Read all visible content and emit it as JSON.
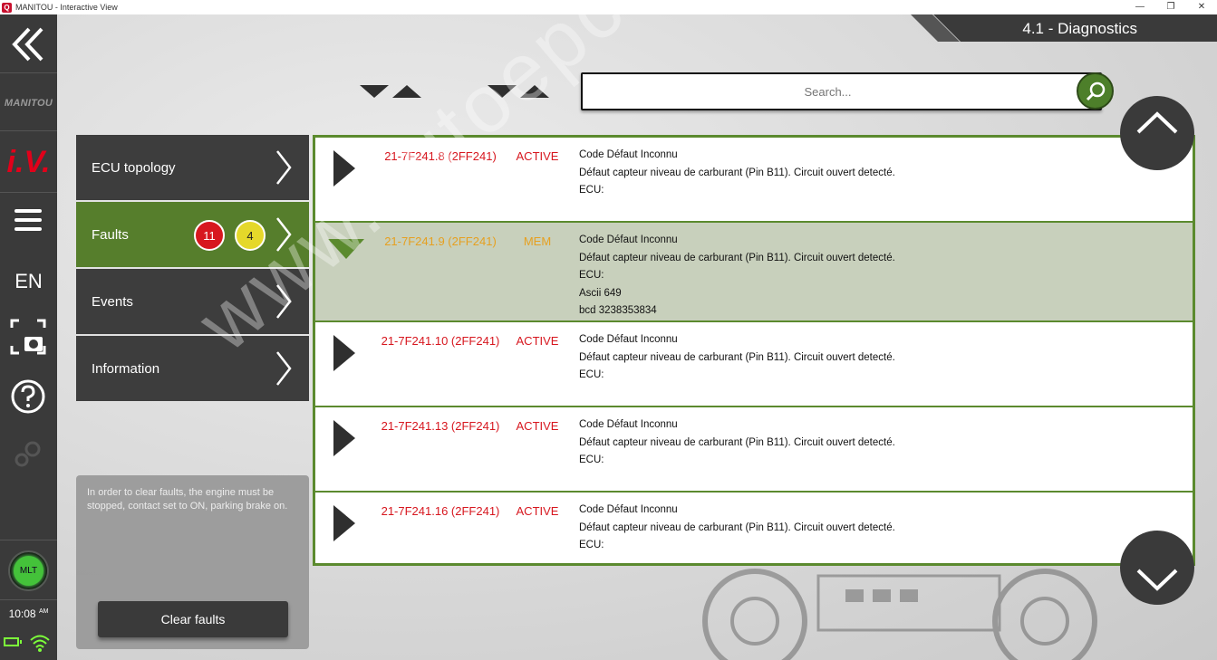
{
  "window": {
    "title": "MANITOU - Interactive View",
    "controls": [
      "—",
      "❐",
      "✕"
    ]
  },
  "rail": {
    "brand": "MANITOU",
    "app_logo": "i.V.",
    "language": "EN",
    "vehicle_badge": "MLT",
    "clock": "10:08",
    "clock_suffix": "AM",
    "icons": [
      "back-chevron-icon",
      "menu-icon",
      "screenshot-icon",
      "help-icon",
      "gear-icon",
      "battery-icon",
      "wifi-icon"
    ]
  },
  "header": {
    "title": "4.1 - Diagnostics"
  },
  "search": {
    "placeholder": "Search..."
  },
  "sidenav": {
    "items": [
      {
        "label": "ECU topology"
      },
      {
        "label": "Faults",
        "badge_red": "11",
        "badge_yellow": "4"
      },
      {
        "label": "Events"
      },
      {
        "label": "Information"
      }
    ]
  },
  "info": {
    "message": "In order to clear faults, the engine must be stopped, contact set to ON, parking brake on.",
    "clear_button": "Clear faults"
  },
  "faults": [
    {
      "code": "21-7F241.8 (2FF241)",
      "status": "ACTIVE",
      "title": "Code Défaut Inconnu",
      "description": "Défaut capteur niveau de carburant (Pin B11). Circuit ouvert detecté.",
      "ecu": "ECU:"
    },
    {
      "code": "21-7F241.9 (2FF241)",
      "status": "MEM",
      "title": "Code Défaut Inconnu",
      "description": "Défaut capteur niveau de carburant (Pin B11). Circuit ouvert detecté.",
      "ecu": "ECU:",
      "ascii": "Ascii  649",
      "bcd": "bcd  3238353834"
    },
    {
      "code": "21-7F241.10 (2FF241)",
      "status": "ACTIVE",
      "title": "Code Défaut Inconnu",
      "description": "Défaut capteur niveau de carburant (Pin B11). Circuit ouvert detecté.",
      "ecu": "ECU:"
    },
    {
      "code": "21-7F241.13 (2FF241)",
      "status": "ACTIVE",
      "title": "Code Défaut Inconnu",
      "description": "Défaut capteur niveau de carburant (Pin B11). Circuit ouvert detecté.",
      "ecu": "ECU:"
    },
    {
      "code": "21-7F241.16 (2FF241)",
      "status": "ACTIVE",
      "title": "Code Défaut Inconnu",
      "description": "Défaut capteur niveau de carburant (Pin B11). Circuit ouvert detecté.",
      "ecu": "ECU:"
    }
  ],
  "watermark": "www.autoepccatalog.com",
  "colors": {
    "accent_green": "#567e2c",
    "active_red": "#d7171f",
    "mem_amber": "#e6a020",
    "rail_dark": "#3a3a3a"
  }
}
